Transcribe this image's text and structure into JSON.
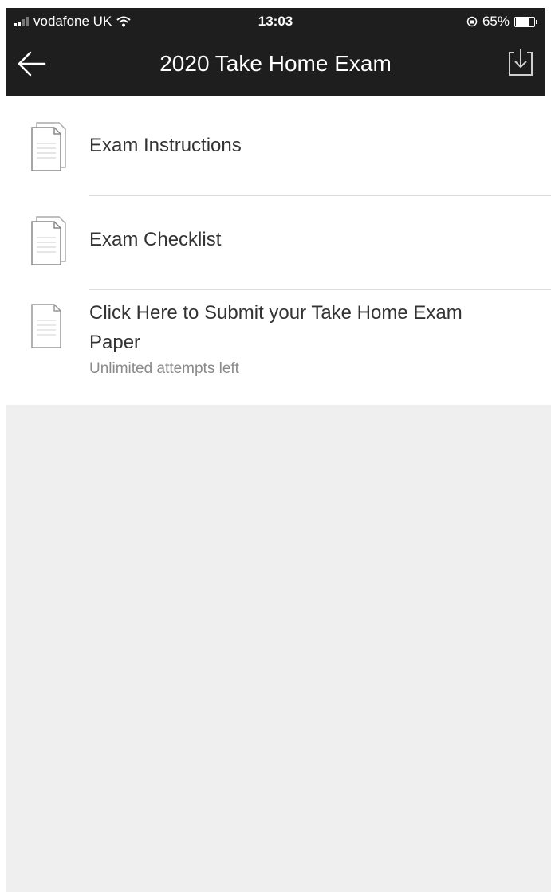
{
  "status_bar": {
    "carrier": "vodafone UK",
    "time": "13:03",
    "battery": "65%"
  },
  "header": {
    "title": "2020 Take Home Exam",
    "icons": [
      "back-arrow-icon",
      "download-icon"
    ]
  },
  "items": [
    {
      "label": "Exam Instructions",
      "icon": "documents-icon"
    },
    {
      "label": "Exam Checklist",
      "icon": "documents-icon"
    },
    {
      "label": "Click Here to Submit your Take Home Exam Paper",
      "subtitle": "Unlimited attempts left",
      "icon": "document-icon"
    }
  ]
}
